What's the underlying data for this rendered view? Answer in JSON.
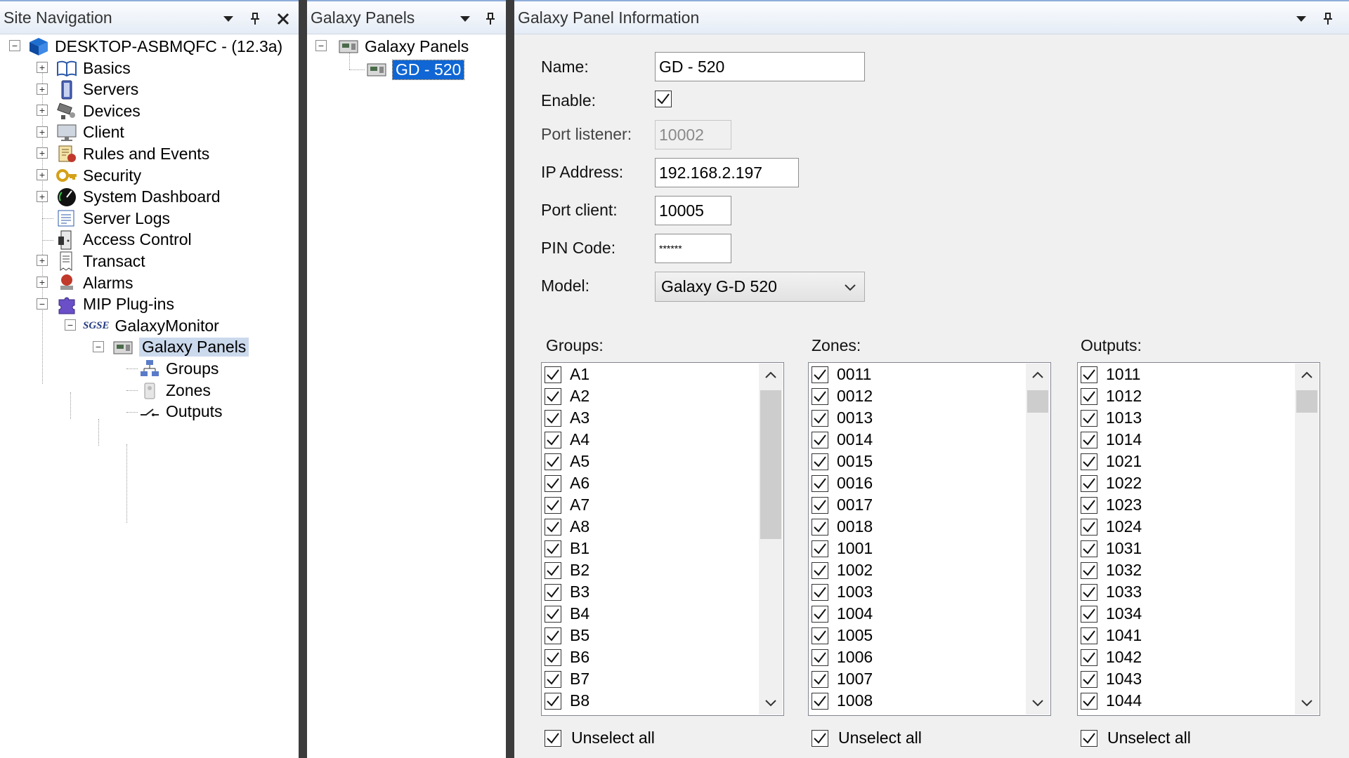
{
  "site_nav": {
    "title": "Site Navigation",
    "root": "DESKTOP-ASBMQFC - (12.3a)",
    "items": [
      {
        "label": "Basics",
        "icon": "book-icon"
      },
      {
        "label": "Servers",
        "icon": "server-icon"
      },
      {
        "label": "Devices",
        "icon": "camera-icon"
      },
      {
        "label": "Client",
        "icon": "monitor-icon"
      },
      {
        "label": "Rules and Events",
        "icon": "rules-icon"
      },
      {
        "label": "Security",
        "icon": "keys-icon"
      },
      {
        "label": "System Dashboard",
        "icon": "gauge-icon"
      },
      {
        "label": "Server Logs",
        "icon": "logs-icon"
      },
      {
        "label": "Access Control",
        "icon": "door-icon"
      },
      {
        "label": "Transact",
        "icon": "receipt-icon"
      },
      {
        "label": "Alarms",
        "icon": "alarm-icon"
      },
      {
        "label": "MIP Plug-ins",
        "icon": "puzzle-icon"
      }
    ],
    "galaxy_monitor": {
      "badge": "SGSE",
      "label": "GalaxyMonitor"
    },
    "galaxy_panels": "Galaxy Panels",
    "sub_items": [
      {
        "label": "Groups",
        "icon": "network-icon"
      },
      {
        "label": "Zones",
        "icon": "zone-icon"
      },
      {
        "label": "Outputs",
        "icon": "switch-icon"
      }
    ]
  },
  "galaxy_panels_pane": {
    "title": "Galaxy Panels",
    "root": "Galaxy Panels",
    "selected": "GD - 520"
  },
  "info": {
    "title": "Galaxy Panel Information",
    "labels": {
      "name": "Name:",
      "enable": "Enable:",
      "port_listener": "Port listener:",
      "ip": "IP Address:",
      "port_client": "Port client:",
      "pin": "PIN Code:",
      "model": "Model:"
    },
    "values": {
      "name": "GD - 520",
      "enable": true,
      "port_listener": "10002",
      "ip": "192.168.2.197",
      "port_client": "10005",
      "pin": "******",
      "model": "Galaxy G-D 520"
    },
    "groups": {
      "label": "Groups:",
      "items": [
        "A1",
        "A2",
        "A3",
        "A4",
        "A5",
        "A6",
        "A7",
        "A8",
        "B1",
        "B2",
        "B3",
        "B4",
        "B5",
        "B6",
        "B7",
        "B8"
      ],
      "unselect": "Unselect all"
    },
    "zones": {
      "label": "Zones:",
      "items": [
        "0011",
        "0012",
        "0013",
        "0014",
        "0015",
        "0016",
        "0017",
        "0018",
        "1001",
        "1002",
        "1003",
        "1004",
        "1005",
        "1006",
        "1007",
        "1008"
      ],
      "unselect": "Unselect all"
    },
    "outputs": {
      "label": "Outputs:",
      "items": [
        "1011",
        "1012",
        "1013",
        "1014",
        "1021",
        "1022",
        "1023",
        "1024",
        "1031",
        "1032",
        "1033",
        "1034",
        "1041",
        "1042",
        "1043",
        "1044"
      ],
      "unselect": "Unselect all"
    }
  }
}
